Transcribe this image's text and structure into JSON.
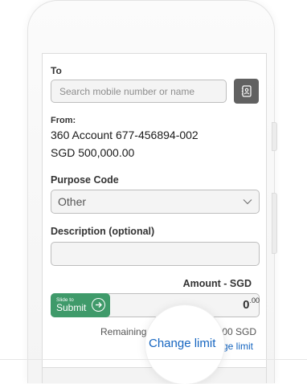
{
  "recipient": {
    "label": "To",
    "search_placeholder": "Search mobile number or name"
  },
  "from": {
    "label": "From:",
    "account": "360 Account 677-456894-002",
    "balance": "SGD 500,000.00"
  },
  "purpose": {
    "label": "Purpose Code",
    "selected": "Other"
  },
  "description": {
    "label": "Description (optional)"
  },
  "amount": {
    "label": "Amount - SGD",
    "whole": "0",
    "cents": ".00"
  },
  "slide_button": {
    "small_text": "Slide to",
    "big_text": "Submit"
  },
  "limit": {
    "remaining_text": "Remaining",
    "remaining_amount_partial": ".00 SGD",
    "change_limit_partial": "ge limit",
    "magnified_link": "Change limit"
  },
  "colors": {
    "accent_green": "#3f9a6a",
    "link_blue": "#1565c0",
    "contacts_button": "#616161"
  }
}
